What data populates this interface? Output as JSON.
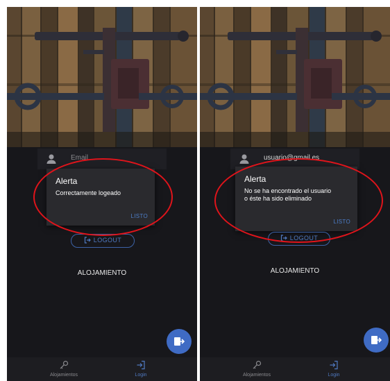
{
  "screens": [
    {
      "email_placeholder": "Email",
      "alert": {
        "title": "Alerta",
        "message": "Correctamente logeado",
        "button": "LISTO"
      },
      "logout_label": "LOGOUT",
      "section_label": "ALOJAMIENTO",
      "nav": {
        "alojamientos": "Alojamientos",
        "login": "Login"
      }
    },
    {
      "email_value": "usuario@gmail.es",
      "alert": {
        "title": "Alerta",
        "message_line1": "No se ha encontrado el usuario",
        "message_line2": "o éste ha sido eliminado",
        "button": "LISTO"
      },
      "logout_label": "LOGOUT",
      "section_label": "ALOJAMIENTO",
      "nav": {
        "alojamientos": "Alojamientos",
        "login": "Login"
      }
    }
  ],
  "icons": {
    "field": "person-icon",
    "logout": "logout-icon",
    "fab": "login-icon",
    "nav_alojamientos": "key-icon",
    "nav_login": "login-icon"
  },
  "colors": {
    "app_background": "#17171b",
    "accent": "#3f6bc4",
    "dialog": "#2a2a2e",
    "highlight": "#e0141b"
  }
}
